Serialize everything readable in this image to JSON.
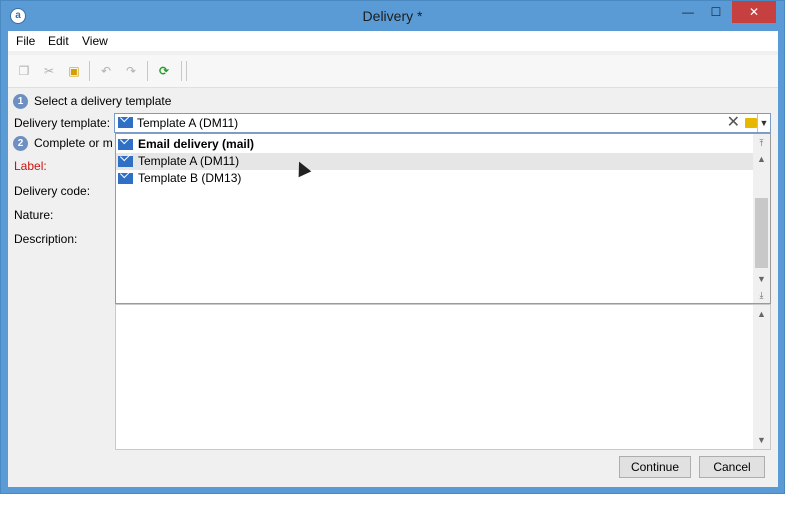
{
  "window": {
    "title": "Delivery *",
    "app_icon": "adobe-icon",
    "minimize": "—",
    "maximize": "☐",
    "close": "✕"
  },
  "menu": {
    "items": [
      "File",
      "Edit",
      "View"
    ]
  },
  "toolbar": {
    "icons": [
      "copy-icon",
      "cut-icon",
      "paste-icon",
      "undo-icon",
      "redo-icon",
      "refresh-icon"
    ]
  },
  "steps": [
    {
      "num": "1",
      "text": "Select a delivery template"
    },
    {
      "num": "2",
      "text": "Complete or m"
    }
  ],
  "form": {
    "template_label": "Delivery template:",
    "template_value": "Template A (DM11)",
    "label_label": "Label:",
    "code_label": "Delivery code:",
    "nature_label": "Nature:",
    "description_label": "Description:"
  },
  "dropdown": {
    "items": [
      {
        "label": "Email delivery (mail)",
        "bold": true
      },
      {
        "label": "Template A (DM11)",
        "hover": true
      },
      {
        "label": "Template B (DM13)"
      }
    ]
  },
  "buttons": {
    "continue": "Continue",
    "cancel": "Cancel"
  },
  "colors": {
    "titlebar": "#5b9bd5",
    "close": "#c74040",
    "required_label": "#cc1111",
    "step_badge": "#6e8fc2"
  }
}
